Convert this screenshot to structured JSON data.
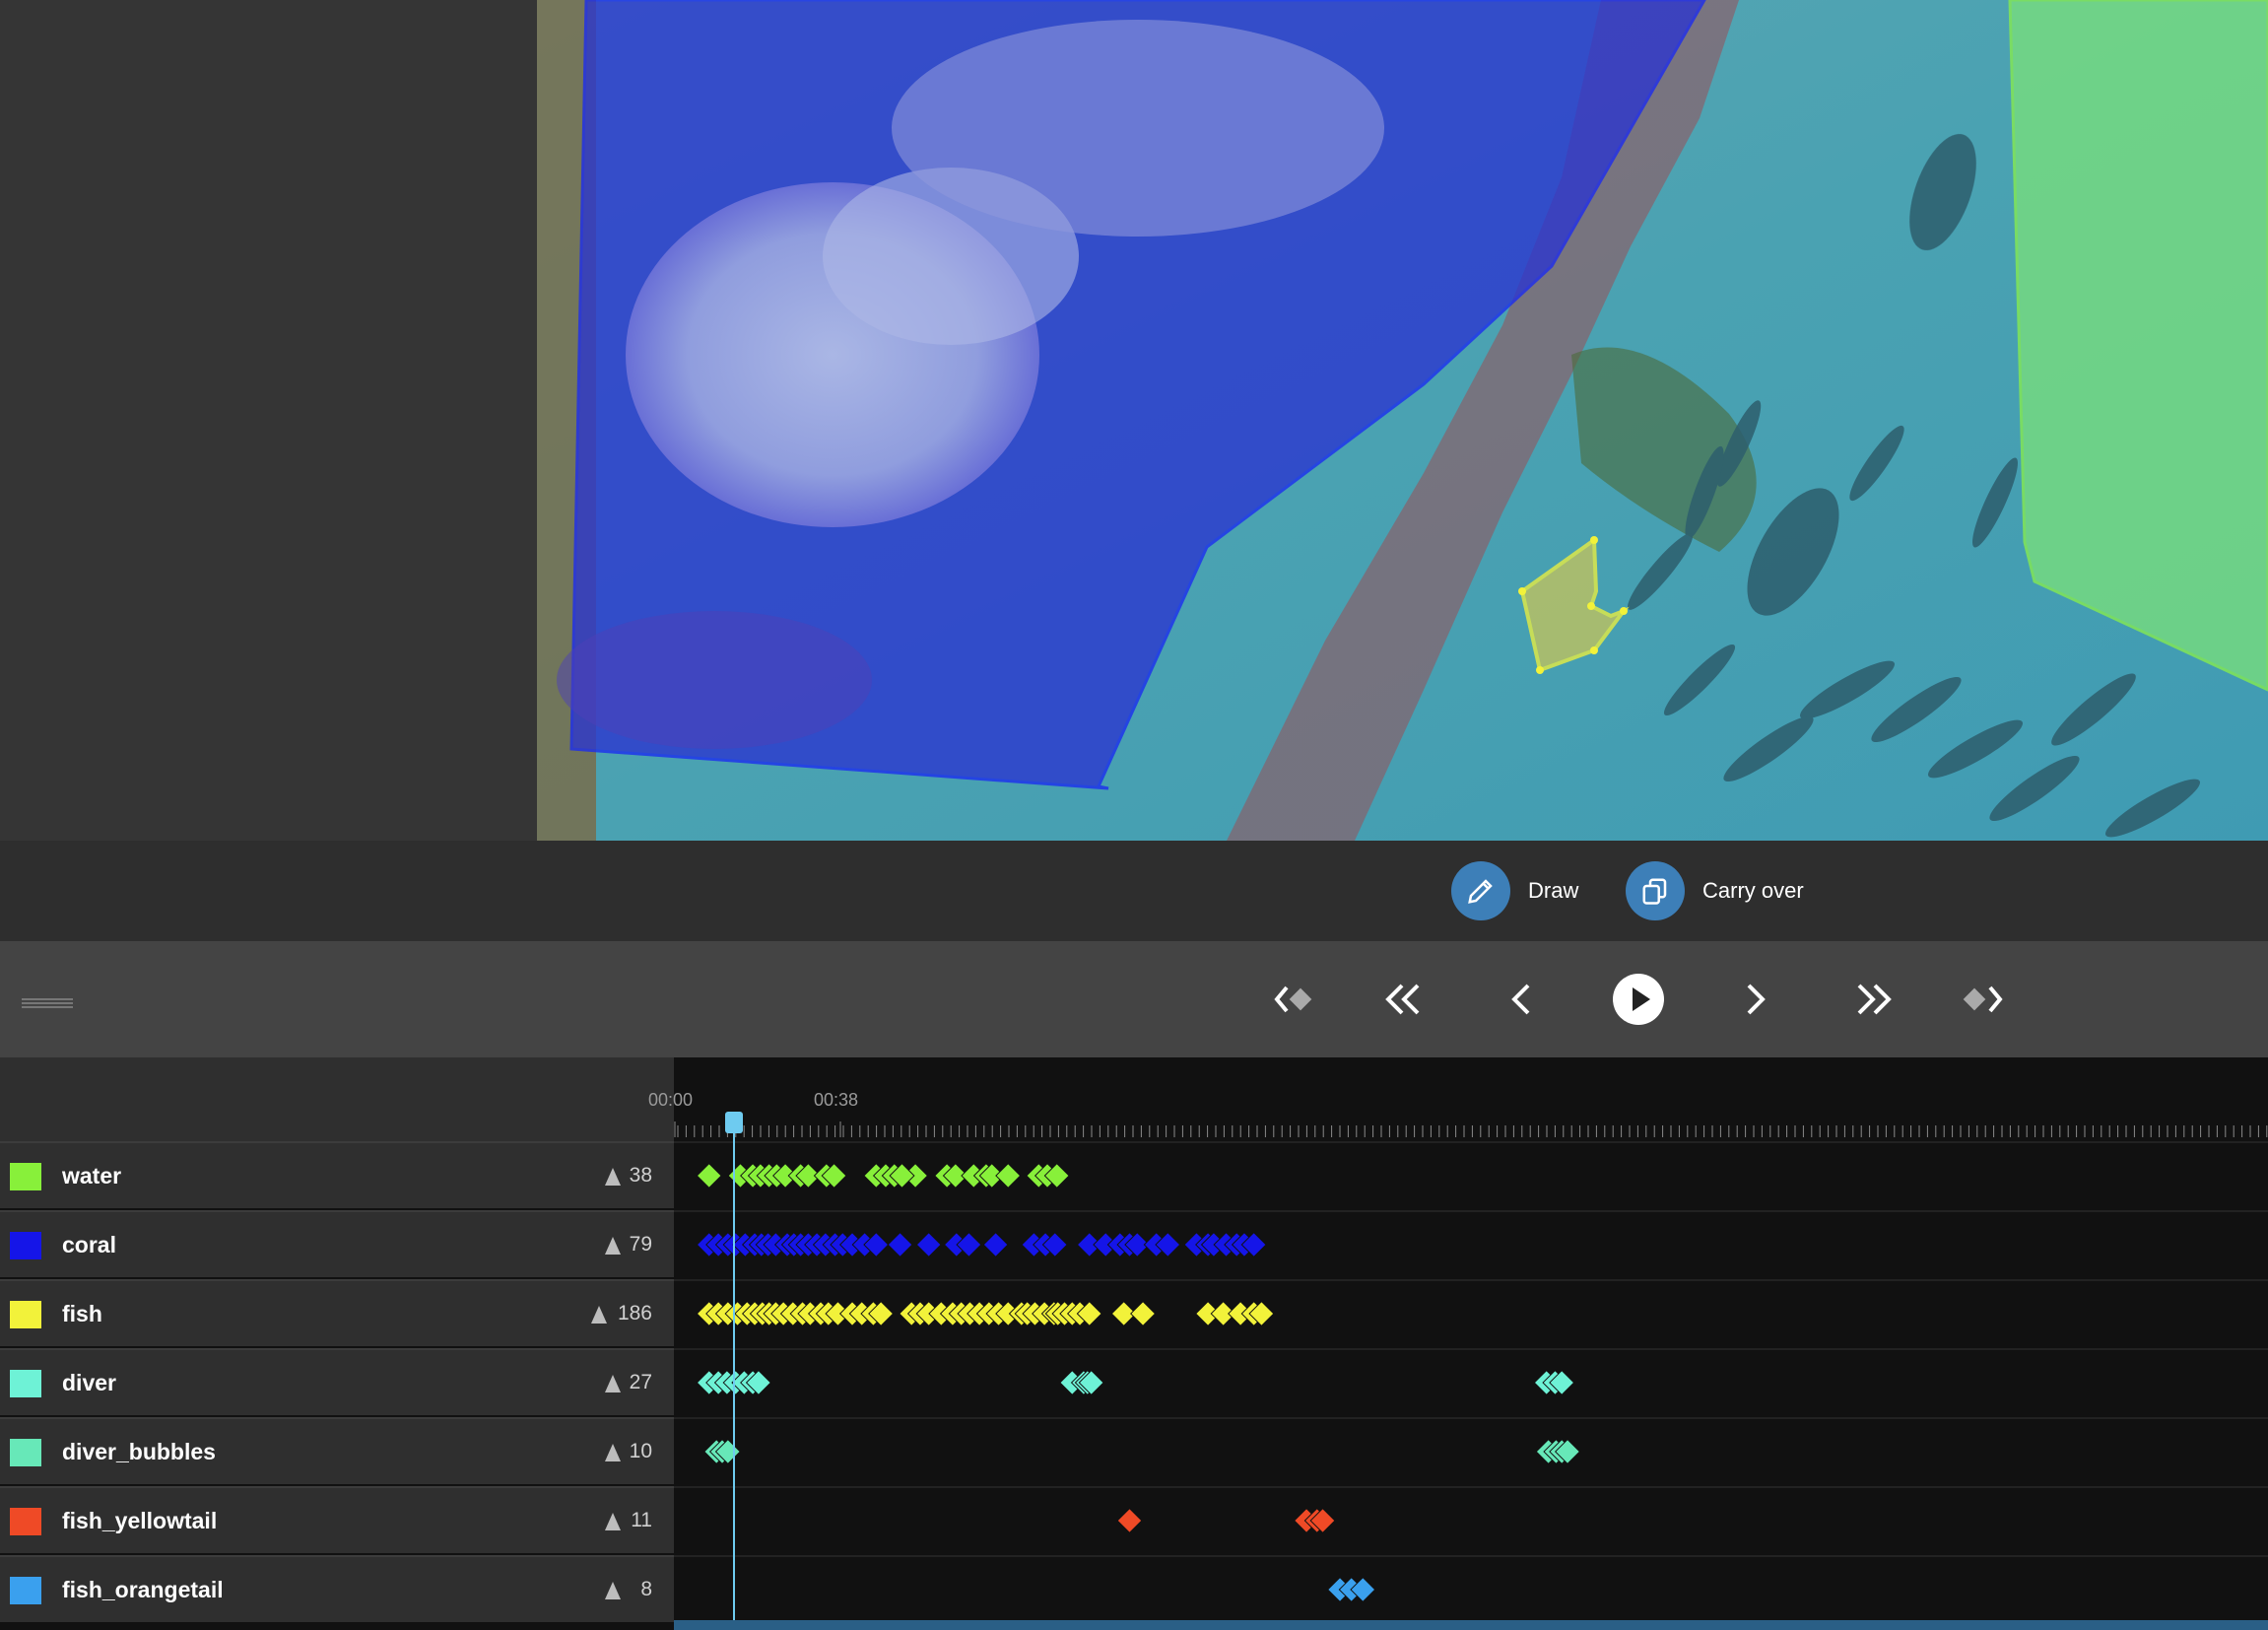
{
  "toolbar": {
    "draw_label": "Draw",
    "carry_over_label": "Carry over",
    "accent": "#3d7fb8"
  },
  "transport": {
    "buttons": [
      "first-keyframe",
      "prev-keyframe-jump",
      "prev-frame",
      "play",
      "next-frame",
      "next-keyframe-jump",
      "last-keyframe"
    ]
  },
  "timeline": {
    "time_labels": [
      "00:00",
      "00:38"
    ],
    "playhead_time": "00:07",
    "tracks": [
      {
        "name": "water",
        "count": "38",
        "color": "#88f03a",
        "keyframes": [
          0.3,
          33,
          46,
          54,
          63,
          71,
          80,
          96,
          104,
          123,
          131,
          175,
          185,
          194,
          216,
          202,
          249,
          258,
          277,
          290,
          296,
          313,
          345,
          354,
          364
        ]
      },
      {
        "name": "coral",
        "count": "79",
        "color": "#1515e8",
        "keyframes": [
          0.3,
          10,
          20,
          28,
          38,
          48,
          55,
          62,
          70,
          82,
          89,
          96,
          104,
          113,
          122,
          132,
          140,
          150,
          163,
          175,
          200,
          230,
          259,
          272,
          300,
          340,
          352,
          362,
          398,
          415,
          430,
          440,
          448,
          468,
          480,
          510,
          522,
          528,
          541,
          552,
          560,
          570
        ]
      },
      {
        "name": "fish",
        "count": "186",
        "color": "#f2f23a",
        "keyframes": [
          0.3,
          10,
          20,
          30,
          40,
          48,
          56,
          63,
          70,
          78,
          88,
          98,
          106,
          117,
          125,
          135,
          150,
          160,
          172,
          180,
          212,
          221,
          230,
          243,
          255,
          264,
          273,
          283,
          293,
          303,
          313,
          327,
          333,
          341,
          351,
          361,
          365,
          372,
          380,
          388,
          398,
          434,
          454,
          522,
          538,
          556,
          570,
          578
        ]
      },
      {
        "name": "diver",
        "count": "27",
        "color": "#6ef2d6",
        "keyframes": [
          0.3,
          10,
          19,
          28,
          37,
          46,
          52,
          380,
          392,
          396,
          400,
          876,
          885,
          892
        ]
      },
      {
        "name": "diver_bubbles",
        "count": "10",
        "color": "#67e8b8",
        "keyframes": [
          8,
          14,
          20,
          878,
          886,
          892,
          898
        ]
      },
      {
        "name": "fish_yellowtail",
        "count": "11",
        "color": "#ef4a26",
        "keyframes": [
          440,
          625,
          636,
          642
        ]
      },
      {
        "name": "fish_orangetail",
        "count": "8",
        "color": "#3aa0ee",
        "keyframes": [
          660,
          672,
          684
        ]
      }
    ]
  }
}
